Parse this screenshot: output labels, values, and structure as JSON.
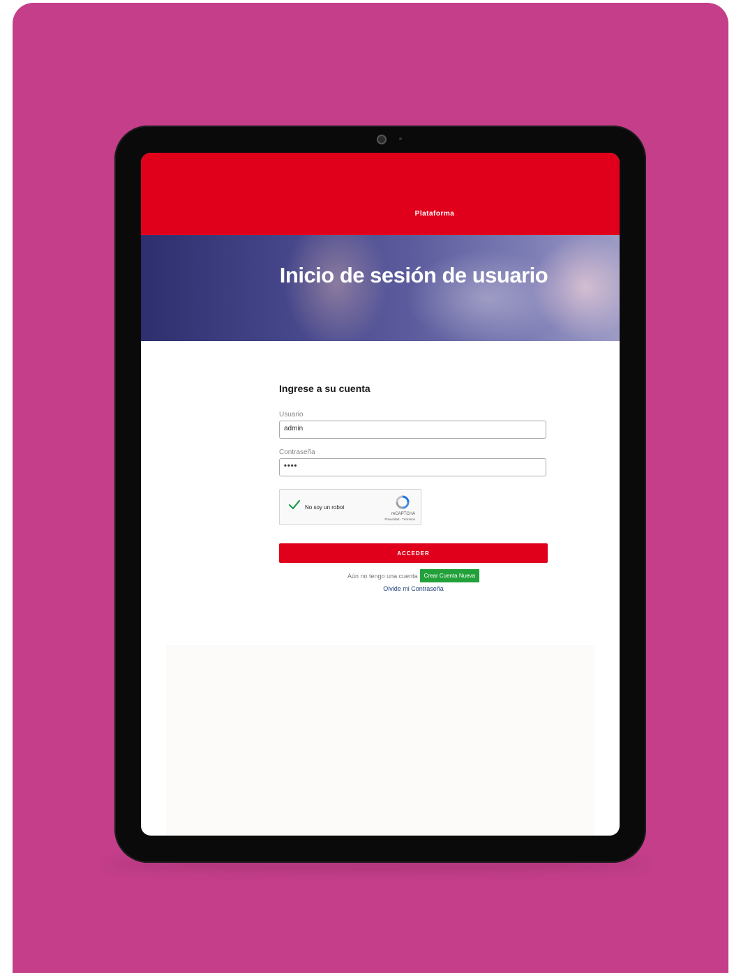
{
  "header": {
    "brand": "Plataforma"
  },
  "hero": {
    "title": "Inicio de sesión de usuario"
  },
  "login": {
    "heading": "Ingrese a su cuenta",
    "username_label": "Usuario",
    "username_value": "admin",
    "password_label": "Contraseña",
    "password_value": "••••",
    "captcha": {
      "text": "No soy un robot",
      "brand": "reCAPTCHA",
      "terms": "Privacidad - Términos",
      "checked": true
    },
    "submit_label": "ACCEDER",
    "no_account_text": "Aún no tengo una cuenta",
    "create_account_label": "Crear Cuenta Nueva",
    "forgot_password_label": "Olvide mi Contraseña"
  },
  "colors": {
    "background": "#c43e8a",
    "primary_red": "#e0001b",
    "create_green": "#22a13a",
    "link_blue": "#1f3f77"
  }
}
